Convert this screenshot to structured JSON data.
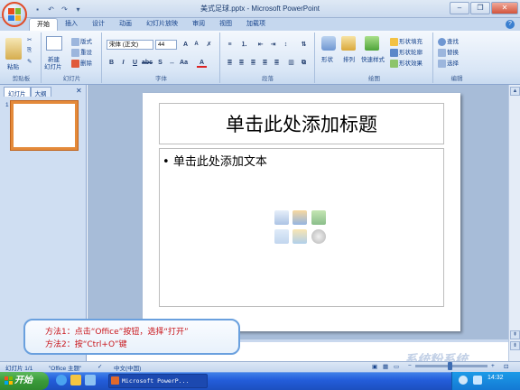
{
  "window": {
    "title": "美式足球.pptx - Microsoft PowerPoint"
  },
  "qat": {
    "save_icon": "save-icon",
    "undo_icon": "undo-icon",
    "redo_icon": "redo-icon"
  },
  "tabs": [
    "开始",
    "插入",
    "设计",
    "动画",
    "幻灯片放映",
    "审阅",
    "视图",
    "加载项"
  ],
  "ribbon": {
    "clipboard": {
      "label": "剪贴板",
      "paste": "粘贴"
    },
    "slides": {
      "label": "幻灯片",
      "new_slide": "新建",
      "new_slide2": "幻灯片",
      "layout": "版式",
      "reset": "重设",
      "delete": "删除"
    },
    "font": {
      "label": "字体",
      "family": "宋体 (正文)",
      "size": "44"
    },
    "paragraph": {
      "label": "段落"
    },
    "drawing": {
      "label": "绘图",
      "shapes": "形状",
      "arrange": "排列",
      "quick_styles": "快速样式",
      "fill": "形状填充",
      "outline": "形状轮廓",
      "effects": "形状效果"
    },
    "editing": {
      "label": "编辑",
      "find": "查找",
      "replace": "替换",
      "select": "选择"
    }
  },
  "pane": {
    "tab_slides": "幻灯片",
    "tab_outline": "大纲",
    "thumb_number": "1"
  },
  "slide": {
    "title_placeholder": "单击此处添加标题",
    "body_placeholder": "单击此处添加文本"
  },
  "callout": {
    "line1": "方法1：点击“Office”按钮，选择“打开”",
    "line2": "方法2：按“Ctrl+O”键"
  },
  "status": {
    "slide_info": "幻灯片 1/1",
    "theme": "\"Office 主题\"",
    "language": "中文(中国)"
  },
  "taskbar": {
    "start": "开始",
    "task": "Microsoft PowerP...",
    "clock": "14:32"
  },
  "watermark": "系统粉系统"
}
